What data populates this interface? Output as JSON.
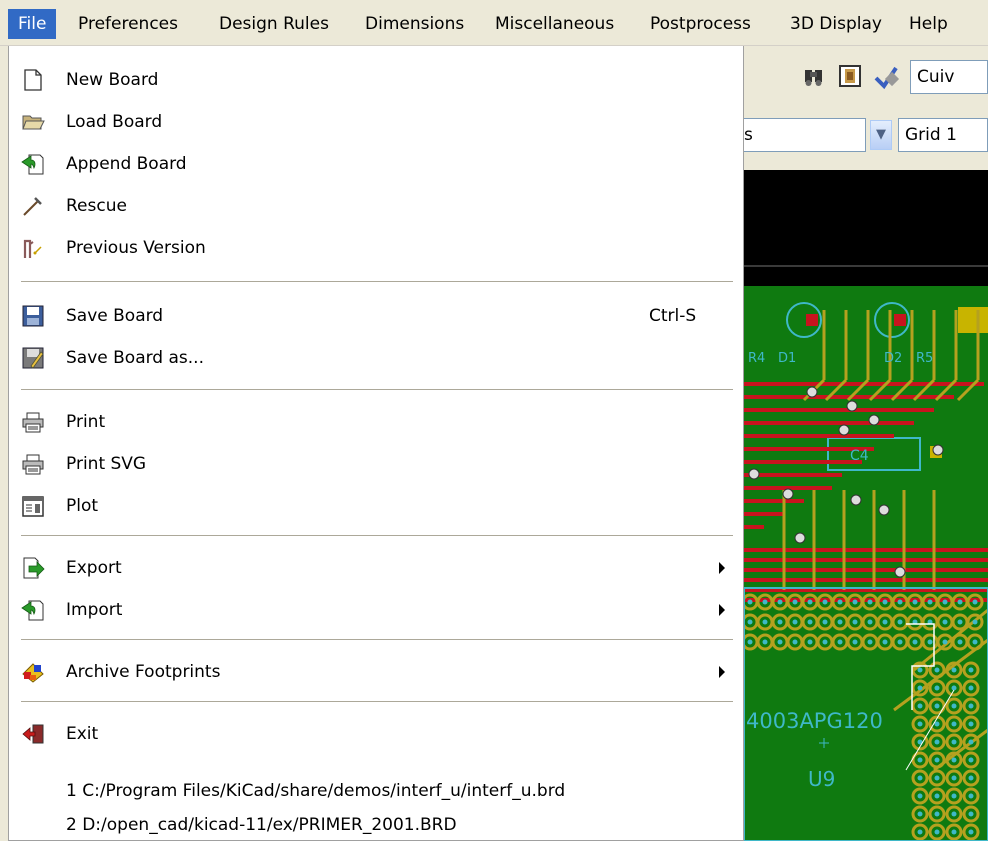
{
  "menubar": {
    "items": [
      "File",
      "Preferences",
      "Design Rules",
      "Dimensions",
      "Miscellaneous",
      "Postprocess",
      "3D Display",
      "Help"
    ],
    "active": "File"
  },
  "toolbar": {
    "combo_top_value": "Cuiv",
    "combo_mid_value": "s",
    "combo_grid_value": "Grid 1"
  },
  "file_menu": {
    "new_board": "New Board",
    "load_board": "Load Board",
    "append_board": "Append Board",
    "rescue": "Rescue",
    "previous_version": "Previous Version",
    "save_board": "Save Board",
    "save_board_shortcut": "Ctrl-S",
    "save_board_as": "Save Board as...",
    "print": "Print",
    "print_svg": "Print SVG",
    "plot": "Plot",
    "export": "Export",
    "import": "Import",
    "archive_footprints": "Archive Footprints",
    "exit": "Exit",
    "recent_1": "1 C:/Program Files/KiCad/share/demos/interf_u/interf_u.brd",
    "recent_2": "2 D:/open_cad/kicad-11/ex/PRIMER_2001.BRD"
  },
  "pcb": {
    "labels": [
      "R4",
      "D1",
      "D2",
      "R5",
      "U9",
      "C4",
      "4003APG120"
    ]
  },
  "colors": {
    "menu_highlight": "#316ac5",
    "pcb_green": "#0f7a10",
    "pcb_yellow": "#b5a11f",
    "pcb_red": "#c8141e",
    "pcb_cyan": "#3fb8c8"
  }
}
